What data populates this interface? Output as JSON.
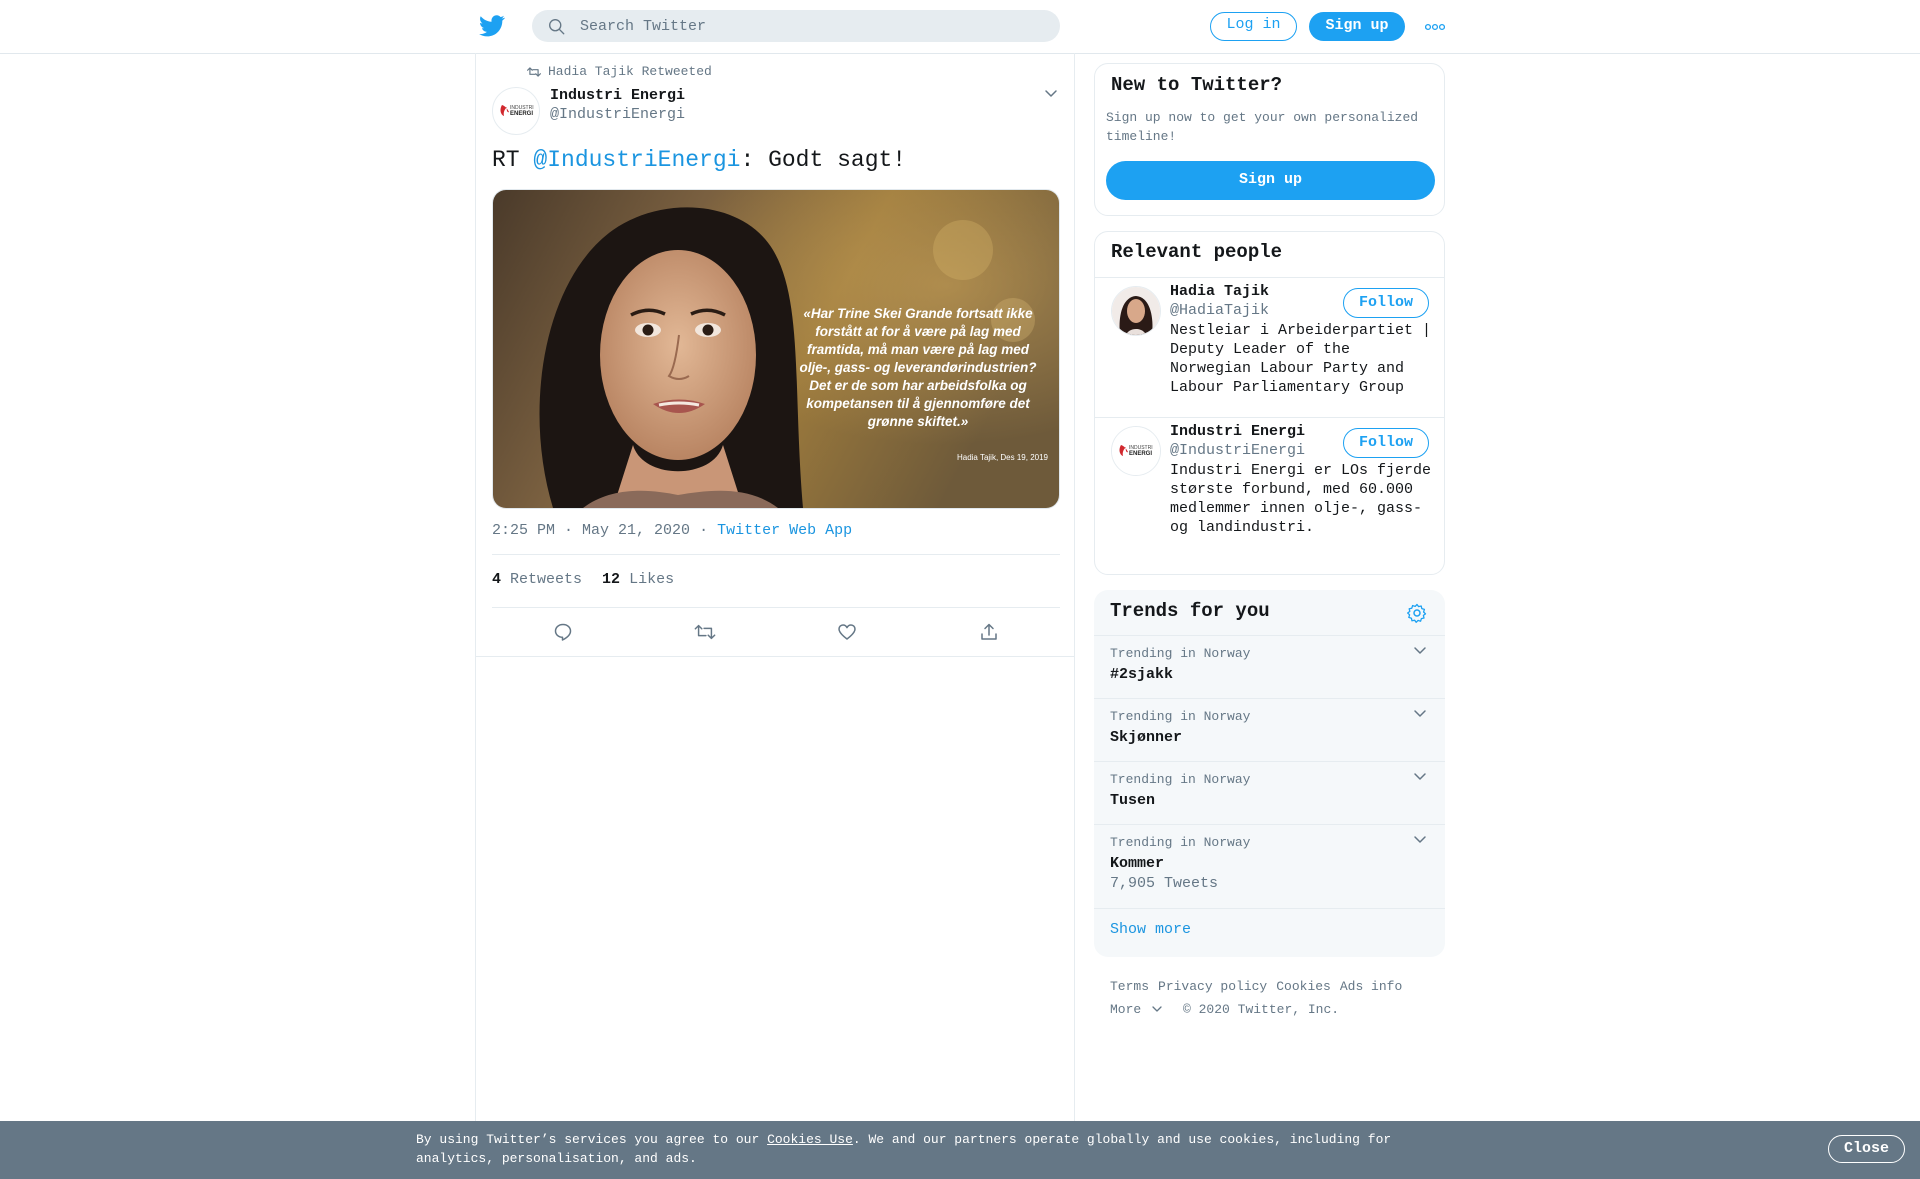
{
  "header": {
    "search_placeholder": "Search Twitter",
    "login_label": "Log in",
    "signup_label": "Sign up",
    "icons": [
      "twitter-bird-icon",
      "search-icon",
      "more-icon"
    ]
  },
  "tweet": {
    "retweet_context": "Hadia Tajik Retweeted",
    "author_name": "Industri Energi",
    "author_handle": "@IndustriEnergi",
    "text_prefix": "RT ",
    "text_mention": "@IndustriEnergi",
    "text_suffix": ": Godt sagt!",
    "media": {
      "quote_lines": [
        "«Har Trine Skei Grande fortsatt ikke",
        "forstått at for å være på lag med",
        "framtida, må man være på lag med",
        "olje-, gass- og leverandørindustrien?",
        "Det er de som har arbeidsfolka og",
        "kompetansen til å gjennomføre det",
        "grønne skiftet.»"
      ],
      "caption": "Hadia Tajik, Des 19, 2019"
    },
    "time": "2:25 PM · May 21, 2020",
    "separator": "·",
    "source": "Twitter Web App",
    "retweets_count": "4",
    "retweets_label": "Retweets",
    "likes_count": "12",
    "likes_label": "Likes",
    "avatar_text": "INDUSTRI ENERGI"
  },
  "new_to_twitter": {
    "title": "New to Twitter?",
    "description": "Sign up now to get your own personalized timeline!",
    "button": "Sign up"
  },
  "relevant_people": {
    "title": "Relevant people",
    "people": [
      {
        "name": "Hadia Tajik",
        "handle": "@HadiaTajik",
        "follow": "Follow",
        "bio": "Nestleiar i Arbeiderpartiet | Deputy Leader of the Norwegian Labour Party and Labour Parliamentary Group"
      },
      {
        "name": "Industri Energi",
        "handle": "@IndustriEnergi",
        "follow": "Follow",
        "bio": "Industri Energi er LOs fjerde største forbund, med 60.000 medlemmer innen olje-, gass- og landindustri."
      }
    ]
  },
  "trends": {
    "title": "Trends for you",
    "items": [
      {
        "context": "Trending in Norway",
        "name": "#2sjakk",
        "count": ""
      },
      {
        "context": "Trending in Norway",
        "name": "Skjønner",
        "count": ""
      },
      {
        "context": "Trending in Norway",
        "name": "Tusen",
        "count": ""
      },
      {
        "context": "Trending in Norway",
        "name": "Kommer",
        "count": "7,905 Tweets"
      }
    ],
    "show_more": "Show more"
  },
  "footer": {
    "links": [
      "Terms",
      "Privacy policy",
      "Cookies",
      "Ads info"
    ],
    "more": "More",
    "copyright": "© 2020 Twitter, Inc."
  },
  "cookie_bar": {
    "text_before": "By using Twitter’s services you agree to our ",
    "link": "Cookies Use",
    "text_after": ". We and our partners operate globally and use cookies, including for analytics, personalisation, and ads.",
    "close": "Close"
  },
  "colors": {
    "accent": "#1da1f2",
    "link": "#1b95e0",
    "secondary_text": "#657786",
    "cookie_bar_bg": "#657786",
    "card_bg": "#f5f8fa"
  }
}
